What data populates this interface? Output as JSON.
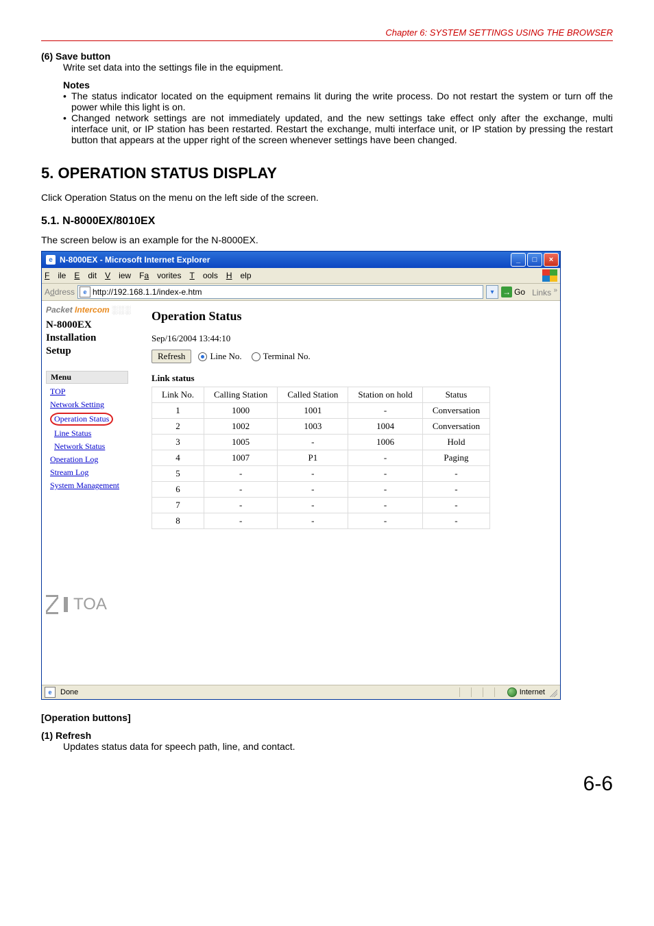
{
  "chapter": "Chapter 6:  SYSTEM SETTINGS USING THE BROWSER",
  "doc": {
    "item6_title": "(6)  Save button",
    "item6_body": "Write set data into the settings file in the equipment.",
    "notes_label": "Notes",
    "note_bullets": [
      "The status indicator located on the equipment remains lit during the write process. Do not restart the system or turn off the power while this light is on.",
      "Changed network settings are not immediately updated, and the new settings take effect only after the exchange, multi interface unit, or IP station has been restarted. Restart the exchange, multi interface unit, or IP station by pressing the restart button that appears at the upper right of the screen whenever settings have been changed."
    ],
    "h5": "5. OPERATION STATUS DISPLAY",
    "h5_intro": "Click Operation Status on the menu on the left side of the screen.",
    "h5_1": "5.1. N-8000EX/8010EX",
    "h5_1_intro": "The screen below is an example for the N-8000EX.",
    "op_btn_hdr": "[Operation buttons]",
    "op_btn_1_title": "(1)  Refresh",
    "op_btn_1_body": "Updates status data for speech path, line, and contact.",
    "page_number": "6-6"
  },
  "browser": {
    "title": "N-8000EX - Microsoft Internet Explorer",
    "menu": {
      "file": "File",
      "edit": "Edit",
      "view": "View",
      "favorites": "Favorites",
      "tools": "Tools",
      "help": "Help"
    },
    "address_label": "Address",
    "url": "http://192.168.1.1/index-e.htm",
    "go": "Go",
    "links": "Links",
    "sidebar": {
      "packet": "Packet",
      "intercom": "Intercom",
      "device_lines": [
        "N-8000EX",
        "Installation",
        "Setup"
      ],
      "menu_header": "Menu",
      "items": {
        "top": "TOP",
        "network_setting": "Network Setting",
        "operation_status": "Operation Status",
        "line_status": "Line Status",
        "network_status": "Network Status",
        "operation_log": "Operation Log",
        "stream_log": "Stream Log",
        "system_management": "System Management"
      },
      "logo_text": "TOA"
    },
    "content": {
      "title": "Operation Status",
      "timestamp": "Sep/16/2004 13:44:10",
      "refresh": "Refresh",
      "radios": {
        "line_no": "Line No.",
        "terminal_no": "Terminal No.",
        "selected": "line_no"
      },
      "table_title": "Link status",
      "columns": [
        "Link No.",
        "Calling Station",
        "Called Station",
        "Station on hold",
        "Status"
      ],
      "rows": [
        [
          "1",
          "1000",
          "1001",
          "-",
          "Conversation"
        ],
        [
          "2",
          "1002",
          "1003",
          "1004",
          "Conversation"
        ],
        [
          "3",
          "1005",
          "-",
          "1006",
          "Hold"
        ],
        [
          "4",
          "1007",
          "P1",
          "-",
          "Paging"
        ],
        [
          "5",
          "-",
          "-",
          "-",
          "-"
        ],
        [
          "6",
          "-",
          "-",
          "-",
          "-"
        ],
        [
          "7",
          "-",
          "-",
          "-",
          "-"
        ],
        [
          "8",
          "-",
          "-",
          "-",
          "-"
        ]
      ]
    },
    "status": {
      "done": "Done",
      "zone": "Internet"
    }
  },
  "chart_data": {
    "type": "table",
    "title": "Link status",
    "columns": [
      "Link No.",
      "Calling Station",
      "Called Station",
      "Station on hold",
      "Status"
    ],
    "rows": [
      [
        "1",
        "1000",
        "1001",
        "-",
        "Conversation"
      ],
      [
        "2",
        "1002",
        "1003",
        "1004",
        "Conversation"
      ],
      [
        "3",
        "1005",
        "-",
        "1006",
        "Hold"
      ],
      [
        "4",
        "1007",
        "P1",
        "-",
        "Paging"
      ],
      [
        "5",
        "-",
        "-",
        "-",
        "-"
      ],
      [
        "6",
        "-",
        "-",
        "-",
        "-"
      ],
      [
        "7",
        "-",
        "-",
        "-",
        "-"
      ],
      [
        "8",
        "-",
        "-",
        "-",
        "-"
      ]
    ]
  }
}
